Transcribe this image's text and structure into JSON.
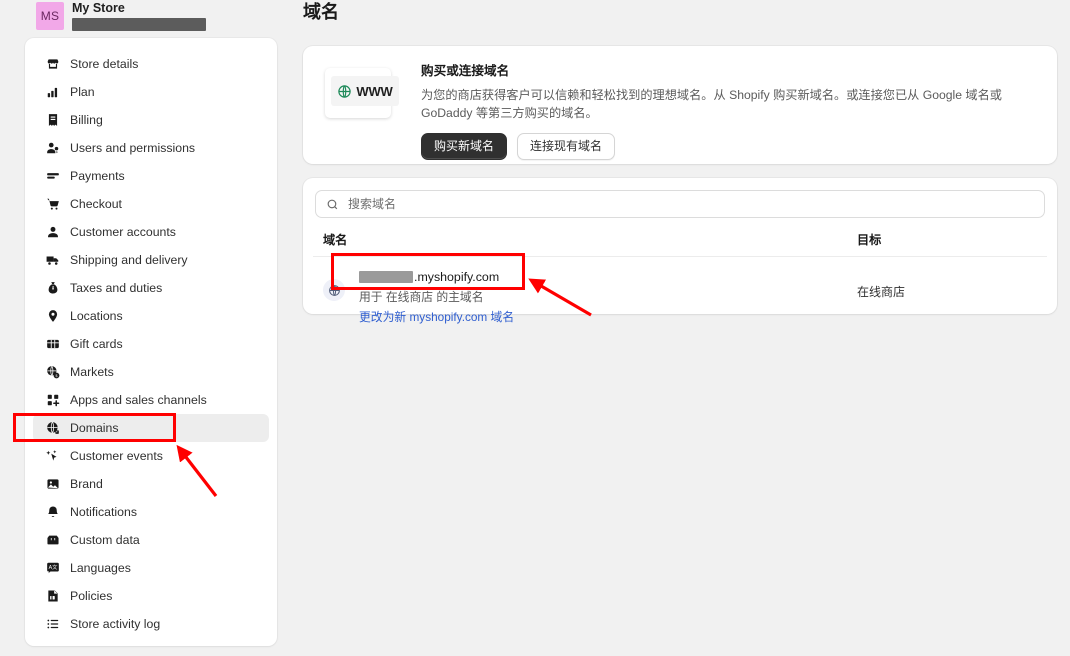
{
  "store": {
    "avatar_initials": "MS",
    "name": "My Store",
    "redacted_url": ""
  },
  "sidebar": {
    "items": [
      {
        "label": "Store details",
        "icon": "store-icon",
        "active": false
      },
      {
        "label": "Plan",
        "icon": "chart-bar-icon",
        "active": false
      },
      {
        "label": "Billing",
        "icon": "receipt-icon",
        "active": false
      },
      {
        "label": "Users and permissions",
        "icon": "users-icon",
        "active": false
      },
      {
        "label": "Payments",
        "icon": "payment-card-icon",
        "active": false
      },
      {
        "label": "Checkout",
        "icon": "shopping-cart-icon",
        "active": false
      },
      {
        "label": "Customer accounts",
        "icon": "person-icon",
        "active": false
      },
      {
        "label": "Shipping and delivery",
        "icon": "truck-icon",
        "active": false
      },
      {
        "label": "Taxes and duties",
        "icon": "money-bag-icon",
        "active": false
      },
      {
        "label": "Locations",
        "icon": "location-pin-icon",
        "active": false
      },
      {
        "label": "Gift cards",
        "icon": "gift-card-icon",
        "active": false
      },
      {
        "label": "Markets",
        "icon": "globe-money-icon",
        "active": false
      },
      {
        "label": "Apps and sales channels",
        "icon": "apps-grid-icon",
        "active": false
      },
      {
        "label": "Domains",
        "icon": "globe-icon",
        "active": true
      },
      {
        "label": "Customer events",
        "icon": "cursor-sparkle-icon",
        "active": false
      },
      {
        "label": "Brand",
        "icon": "brand-image-icon",
        "active": false
      },
      {
        "label": "Notifications",
        "icon": "bell-icon",
        "active": false
      },
      {
        "label": "Custom data",
        "icon": "database-icon",
        "active": false
      },
      {
        "label": "Languages",
        "icon": "translate-icon",
        "active": false
      },
      {
        "label": "Policies",
        "icon": "policy-document-icon",
        "active": false
      },
      {
        "label": "Store activity log",
        "icon": "list-icon",
        "active": false
      }
    ]
  },
  "main": {
    "page_title": "域名",
    "buy_card": {
      "illustration_label": "WWW",
      "illustration_icon": "globe-icon",
      "title": "购买或连接域名",
      "description": "为您的商店获得客户可以信赖和轻松找到的理想域名。从 Shopify 购买新域名。或连接您已从 Google 域名或 GoDaddy 等第三方购买的域名。",
      "primary_button": "购买新域名",
      "secondary_button": "连接现有域名"
    },
    "list_card": {
      "search_placeholder": "搜索域名",
      "search_value": "",
      "columns": {
        "domain": "域名",
        "target": "目标"
      },
      "rows": [
        {
          "icon": "globe-icon",
          "domain_redacted": "",
          "domain_suffix": ".myshopify.com",
          "subtitle": "用于 在线商店 的主域名",
          "link": "更改为新 myshopify.com 域名",
          "target": "在线商店"
        }
      ]
    }
  },
  "annotations": {
    "highlight_color": "#ff0000",
    "boxes": [
      {
        "name": "domains-sidebar-highlight"
      },
      {
        "name": "domain-name-highlight"
      }
    ],
    "arrows": [
      {
        "name": "arrow-to-domains"
      },
      {
        "name": "arrow-to-domain-name"
      }
    ]
  }
}
